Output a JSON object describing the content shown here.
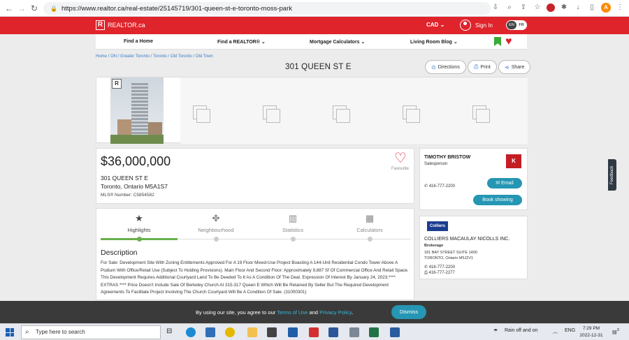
{
  "browser": {
    "url": "https://www.realtor.ca/real-estate/25145719/301-queen-st-e-toronto-moss-park",
    "back": "←",
    "forward": "→",
    "reload": "↻",
    "profile_initial": "A"
  },
  "header": {
    "logo_text": "REALTOR.ca",
    "logo_mark": "R",
    "currency": "CAD",
    "sign_in": "Sign In",
    "lang_en": "EN",
    "lang_fr": "FR",
    "brand_color": "#e0242c"
  },
  "nav": {
    "find_home": "Find a Home",
    "find_realtor": "Find a REALTOR®",
    "mortgage": "Mortgage Calculators",
    "blog": "Living Room Blog"
  },
  "breadcrumb": [
    "Home",
    "ON",
    "Greater Toronto",
    "Toronto",
    "Old Toronto",
    "Old Town"
  ],
  "listing": {
    "title": "301 QUEEN ST E",
    "directions": "Directions",
    "print": "Print",
    "share": "Share",
    "price": "$36,000,000",
    "address_line1": "301 QUEEN ST E",
    "address_line2": "Toronto, Ontario M5A1S7",
    "mls": "MLS® Number: C5854582",
    "favourite": "Favourite"
  },
  "tabs": [
    {
      "label": "Highlights",
      "icon": "★"
    },
    {
      "label": "Neighbourhood",
      "icon": "✤"
    },
    {
      "label": "Statistics",
      "icon": "▥"
    },
    {
      "label": "Calculators",
      "icon": "▦"
    }
  ],
  "description": {
    "heading": "Description",
    "text": "For Sale: Development Site With Zoning Entitlements Approved For A 19 Floor Mixed-Use Project Boasting A 144-Unit Residential Condo Tower Above A Podium With Office/Retail Use (Subject To Holding Provisions). Main Floor And Second Floor: Approximately 9,887 Sf Of Commercial Office And Retail Space. This Development Requires Additional Courtyard Land To Be Deeded To It As A Condition Of The Deal. Expression Of Interest By January 24, 2023.**** EXTRAS **** Price Doesn't Include Sale Of Berkeley Church At 315-317 Queen E Which Will Be Retained By Seller But The Required Development Agreements To Facilitate Project Involving The Church Courtyard Will Be A Condition Of Sale. (31000301)"
  },
  "agent": {
    "name": "TIMOTHY BRISTOW",
    "role": "Salesperson",
    "phone": "416-777-2200",
    "email_btn": "Email",
    "book_btn": "Book showing",
    "logo": "K"
  },
  "brokerage": {
    "logo": "Colliers",
    "name": "COLLIERS MACAULAY NICOLLS INC.",
    "role": "Brokerage",
    "address1": "181 BAY STREET SUITE 1400",
    "address2": "TORONTO, Ontario M5J2V1",
    "phone": "416-777-2200",
    "fax": "416-777-2277"
  },
  "feedback": "Feedback",
  "cookie": {
    "prefix": "By using our site, you agree to our ",
    "terms": "Terms of Use",
    "and": " and ",
    "privacy": "Privacy Policy",
    "period": ".",
    "dismiss": "Dismiss"
  },
  "taskbar": {
    "search_placeholder": "Type here to search",
    "weather": "Rain off and on",
    "lang": "ENG",
    "time": "7:29 PM",
    "date": "2022-12-31",
    "notification_count": "3"
  }
}
